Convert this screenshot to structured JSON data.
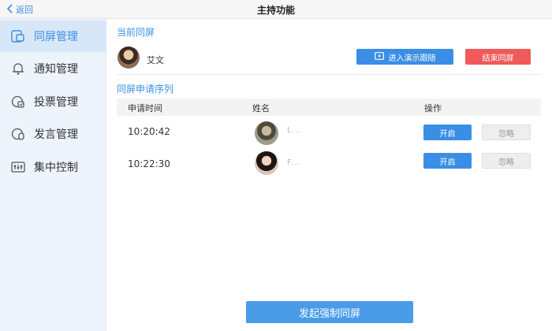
{
  "header": {
    "back_label": "返回",
    "title": "主持功能"
  },
  "sidebar": {
    "items": [
      {
        "label": "同屏管理",
        "icon": "screen-share-icon",
        "active": true
      },
      {
        "label": "通知管理",
        "icon": "bell-icon",
        "active": false
      },
      {
        "label": "投票管理",
        "icon": "vote-icon",
        "active": false
      },
      {
        "label": "发言管理",
        "icon": "speech-icon",
        "active": false
      },
      {
        "label": "集中控制",
        "icon": "control-panel-icon",
        "active": false
      }
    ]
  },
  "current": {
    "section_title": "当前同屏",
    "name": "艾文",
    "enter_button": "进入演示跟随",
    "end_button": "结束同屏"
  },
  "queue": {
    "section_title": "同屏申请序列",
    "columns": [
      "申请时间",
      "姓名",
      "操作"
    ],
    "rows": [
      {
        "time": "10:20:42",
        "name": "L...",
        "accept": "开启",
        "ignore": "忽略"
      },
      {
        "time": "10:22:30",
        "name": "F...",
        "accept": "开启",
        "ignore": "忽略"
      }
    ]
  },
  "footer": {
    "force_button": "发起强制同屏"
  },
  "colors": {
    "accent": "#3a8ee6",
    "danger": "#f05a5a",
    "sidebar_bg": "#eef4fb",
    "sidebar_active": "#d8e7f8"
  }
}
